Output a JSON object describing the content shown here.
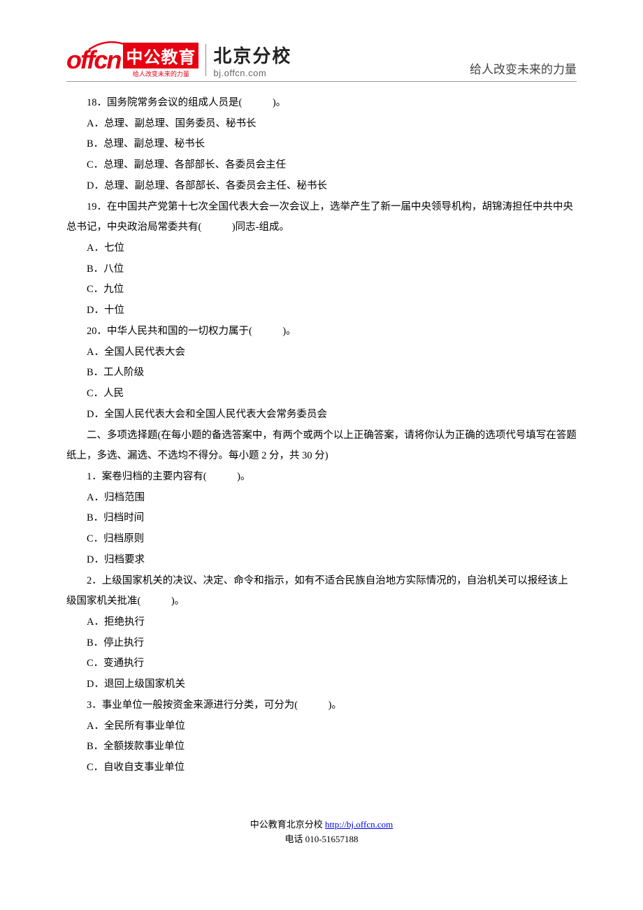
{
  "header": {
    "logo_text": "offcn",
    "brand_cn": "中公教育",
    "brand_sub": "给人改变未来的力量",
    "branch": "北京分校",
    "branch_url": "bj.offcn.com",
    "slogan": "给人改变未来的力量"
  },
  "questions": [
    {
      "q": "18．国务院常务会议的组成人员是(　　　)。",
      "opts": [
        "A．总理、副总理、国务委员、秘书长",
        "B．总理、副总理、秘书长",
        "C．总理、副总理、各部部长、各委员会主任",
        "D．总理、副总理、各部部长、各委员会主任、秘书长"
      ]
    },
    {
      "q": "19．在中国共产党第十七次全国代表大会一次会议上，选举产生了新一届中央领导机构，胡锦涛担任中共中央总书记，中央政治局常委共有(　　　)同志-组成。",
      "opts": [
        "A．七位",
        "B．八位",
        "C．九位",
        "D．十位"
      ]
    },
    {
      "q": "20．中华人民共和国的一切权力属于(　　　)。",
      "opts": [
        "A．全国人民代表大会",
        "B．工人阶级",
        "C．人民",
        "D．全国人民代表大会和全国人民代表大会常务委员会"
      ]
    }
  ],
  "section2": {
    "title": "二、多项选择题(在每小题的备选答案中，有两个或两个以上正确答案，请将你认为正确的选项代号填写在答题纸上，多选、漏选、不选均不得分。每小题 2 分，共 30 分)",
    "questions": [
      {
        "q": "1．案卷归档的主要内容有(　　　)。",
        "opts": [
          "A．归档范围",
          "B．归档时间",
          "C．归档原则",
          "D．归档要求"
        ]
      },
      {
        "q": "2．上级国家机关的决议、决定、命令和指示，如有不适合民族自治地方实际情况的，自治机关可以报经该上级国家机关批准(　　　)。",
        "opts": [
          "A．拒绝执行",
          "B．停止执行",
          "C．变通执行",
          "D．退回上级国家机关"
        ]
      },
      {
        "q": "3．事业单位一般按资金来源进行分类，可分为(　　　)。",
        "opts": [
          "A．全民所有事业单位",
          "B．全额拨款事业单位",
          "C．自收自支事业单位"
        ]
      }
    ]
  },
  "footer": {
    "line1_prefix": "中公教育北京分校 ",
    "line1_link": "http://bj.offcn.com",
    "line2": "电话 010-51657188"
  }
}
